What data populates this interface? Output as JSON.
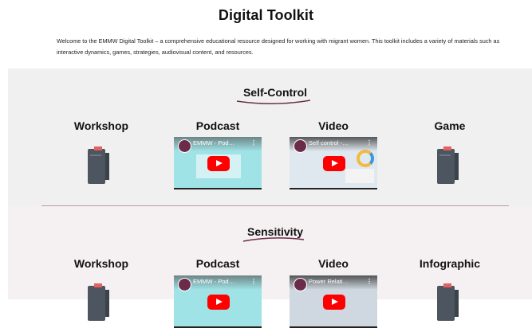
{
  "page": {
    "title": "Digital Toolkit",
    "intro": "Welcome to the EMMW Digital Toolkit – a comprehensive educational resource designed for working with migrant women. This toolkit includes a variety of materials such as interactive dynamics, games, strategies, audiovisual content, and resources."
  },
  "sections": [
    {
      "title": "Self-Control",
      "columns": [
        "Workshop",
        "Podcast",
        "Video",
        "Game"
      ],
      "podcast_video_title": "EMMW - Pod…",
      "video_title": "Self control -…"
    },
    {
      "title": "Sensitivity",
      "columns": [
        "Workshop",
        "Podcast",
        "Video",
        "Infographic"
      ],
      "podcast_video_title": "EMMW - Pod…",
      "video_title": "Power Relati…"
    }
  ],
  "colors": {
    "accent": "#6b2c49",
    "section1_bg": "#f0f0f0",
    "section2_bg": "#f5f0f2",
    "youtube_red": "#ff0000",
    "binder": "#4d5660"
  },
  "icons": {
    "binder": "binder-icon",
    "play": "youtube-play-icon",
    "channel": "channel-avatar-icon",
    "menu": "more-vert-icon"
  }
}
